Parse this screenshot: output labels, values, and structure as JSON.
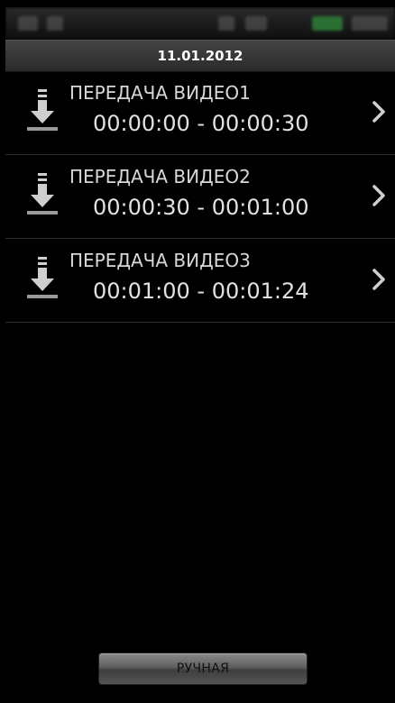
{
  "header": {
    "date": "11.01.2012"
  },
  "list": {
    "items": [
      {
        "title": "ПЕРЕДАЧА ВИДЕО1",
        "range": "00:00:00 - 00:00:30",
        "icon": "download-icon"
      },
      {
        "title": "ПЕРЕДАЧА ВИДЕО2",
        "range": "00:00:30 - 00:01:00",
        "icon": "download-icon"
      },
      {
        "title": "ПЕРЕДАЧА ВИДЕО3",
        "range": "00:01:00 - 00:01:24",
        "icon": "download-icon"
      }
    ]
  },
  "footer": {
    "manual_label": "РУЧНАЯ"
  },
  "colors": {
    "background": "#000000",
    "header_bar": "#3a3a3a",
    "text": "#e2e2e2",
    "divider": "#2c2c2c",
    "button": "#5e5e5e"
  }
}
